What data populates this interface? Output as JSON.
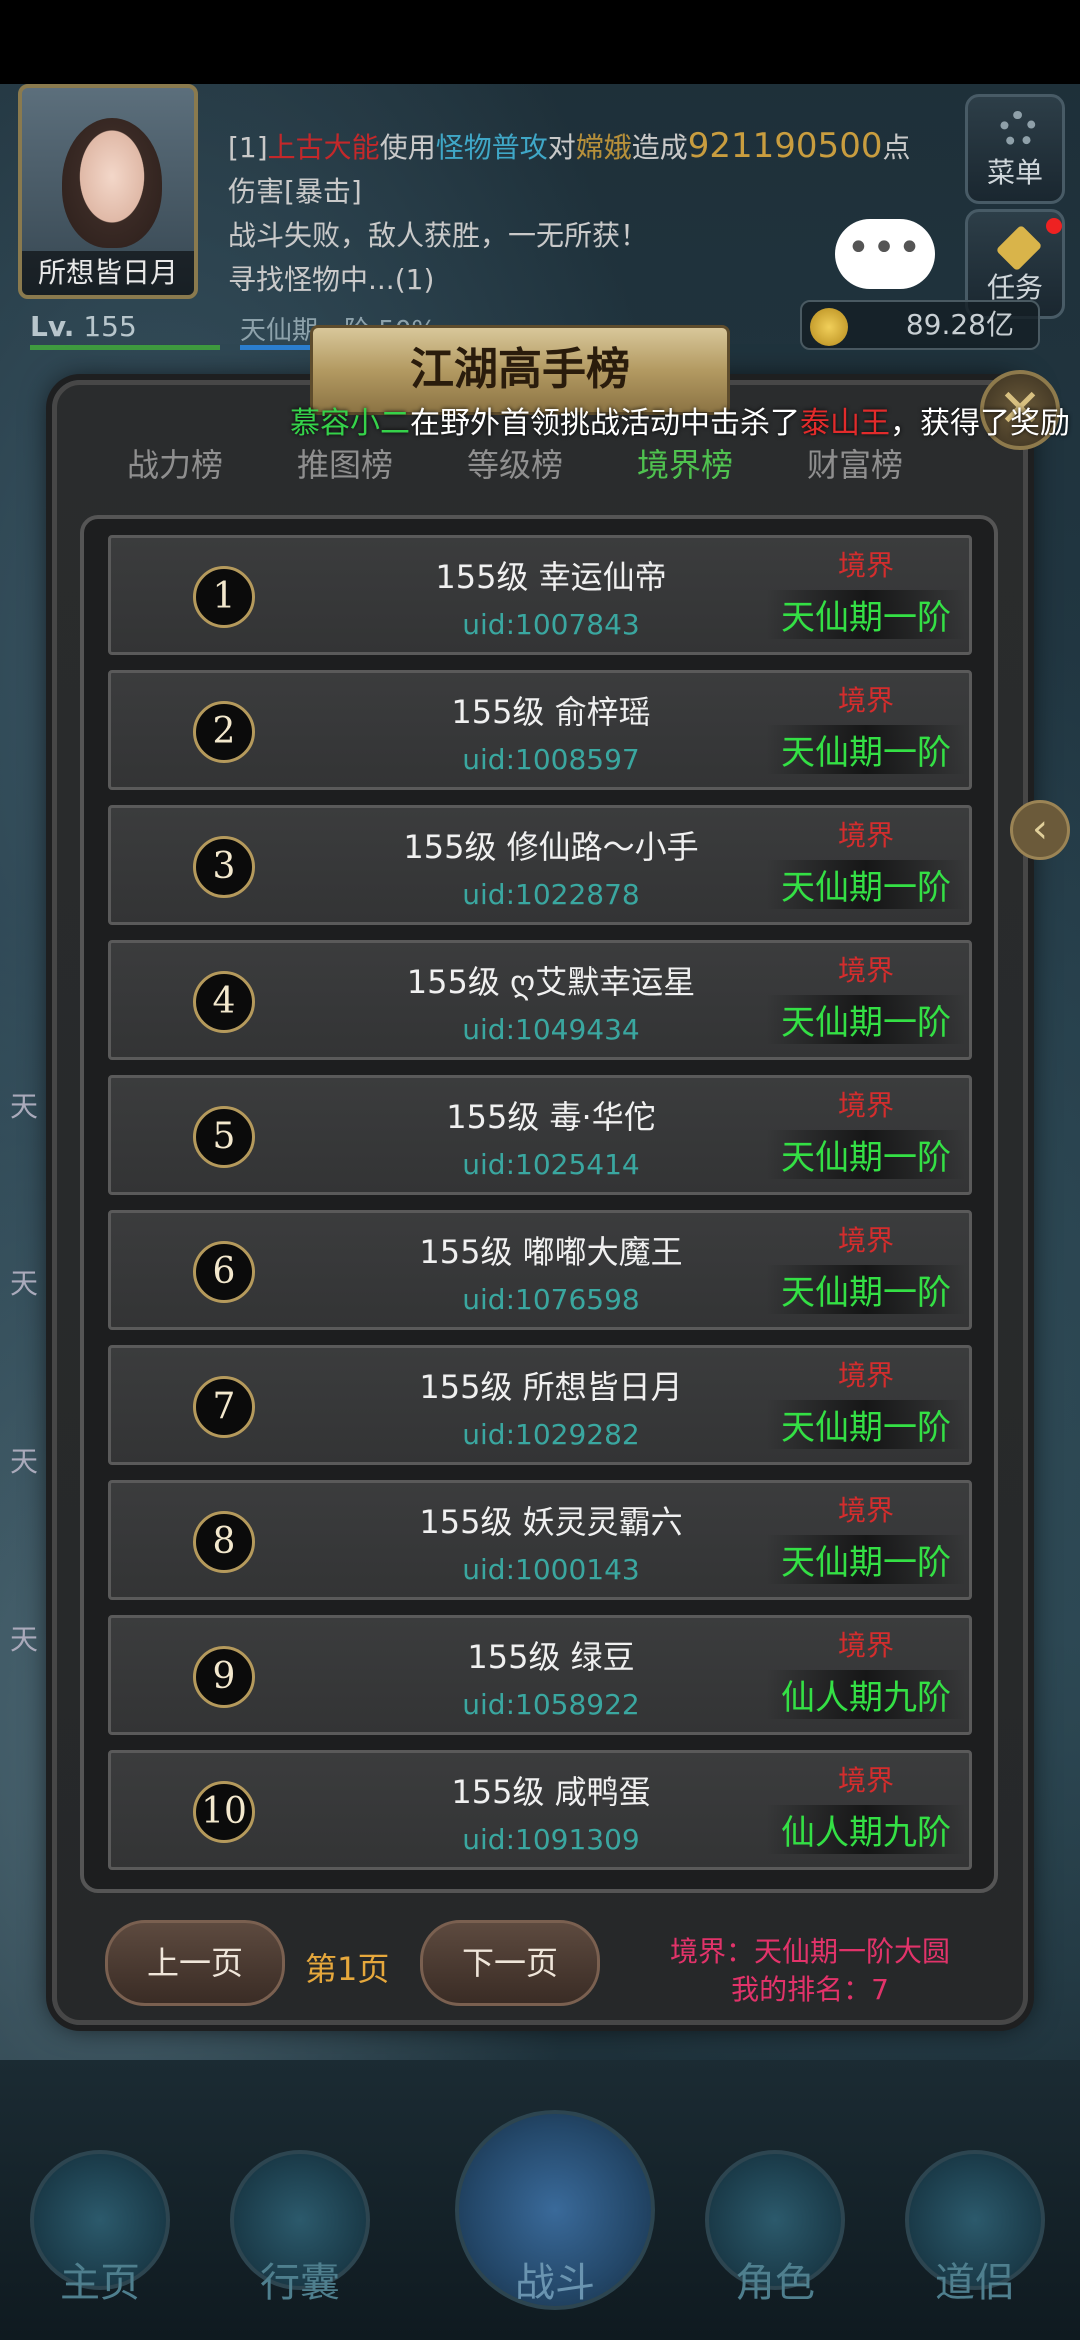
{
  "player": {
    "name": "所想皆日月",
    "level_label": "Lv.",
    "level": "155",
    "realm": "天仙期一阶",
    "realm_pct": "50%",
    "money": "89.28亿"
  },
  "battle_log": {
    "line1_prefix": "[1]",
    "line1_actor": "上古大能",
    "line1_use": "使用",
    "line1_skill": "怪物普攻",
    "line1_to": "对",
    "line1_target": "嫦娥",
    "line1_cause": "造成",
    "line1_damage": "921190500",
    "line1_unit": "点",
    "line2": "伤害[暴击]",
    "line3": "战斗失败，敌人获胜，一无所获！",
    "line4": "寻找怪物中...(1)"
  },
  "hud_buttons": {
    "menu": "菜单",
    "task": "任务",
    "chat": "•••"
  },
  "panel": {
    "title": "江湖高手榜",
    "close": "✕",
    "side_arrow": "‹"
  },
  "broadcast": {
    "player": "慕容小二",
    "text1": "在野外首领挑战活动中击杀了",
    "boss": "泰山王",
    "text2": "，获得了奖励"
  },
  "tabs": [
    "战力榜",
    "推图榜",
    "等级榜",
    "境界榜",
    "财富榜"
  ],
  "active_tab": "境界榜",
  "realm_label": "境界",
  "rows": [
    {
      "rank": "1",
      "name": "155级 幸运仙帝",
      "uid": "uid:1007843",
      "realm": "天仙期一阶"
    },
    {
      "rank": "2",
      "name": "155级 俞梓瑶",
      "uid": "uid:1008597",
      "realm": "天仙期一阶"
    },
    {
      "rank": "3",
      "name": "155级 修仙路～小手",
      "uid": "uid:1022878",
      "realm": "天仙期一阶"
    },
    {
      "rank": "4",
      "name": "155级 ღ艾默幸运星",
      "uid": "uid:1049434",
      "realm": "天仙期一阶"
    },
    {
      "rank": "5",
      "name": "155级 毒·华佗",
      "uid": "uid:1025414",
      "realm": "天仙期一阶"
    },
    {
      "rank": "6",
      "name": "155级 嘟嘟大魔王",
      "uid": "uid:1076598",
      "realm": "天仙期一阶"
    },
    {
      "rank": "7",
      "name": "155级 所想皆日月",
      "uid": "uid:1029282",
      "realm": "天仙期一阶"
    },
    {
      "rank": "8",
      "name": "155级 妖灵灵霸六",
      "uid": "uid:1000143",
      "realm": "天仙期一阶"
    },
    {
      "rank": "9",
      "name": "155级 绿豆",
      "uid": "uid:1058922",
      "realm": "仙人期九阶"
    },
    {
      "rank": "10",
      "name": "155级 咸鸭蛋",
      "uid": "uid:1091309",
      "realm": "仙人期九阶"
    }
  ],
  "pagination": {
    "prev": "上一页",
    "page": "第1页",
    "next": "下一页"
  },
  "my_info": {
    "realm": "境界：天仙期一阶大圆",
    "rank": "我的排名：7"
  },
  "side_chars": [
    "天",
    "天",
    "天",
    "天"
  ],
  "nav": {
    "home": "主页",
    "bag": "行囊",
    "battle": "战斗",
    "role": "角色",
    "partner": "道侣"
  }
}
